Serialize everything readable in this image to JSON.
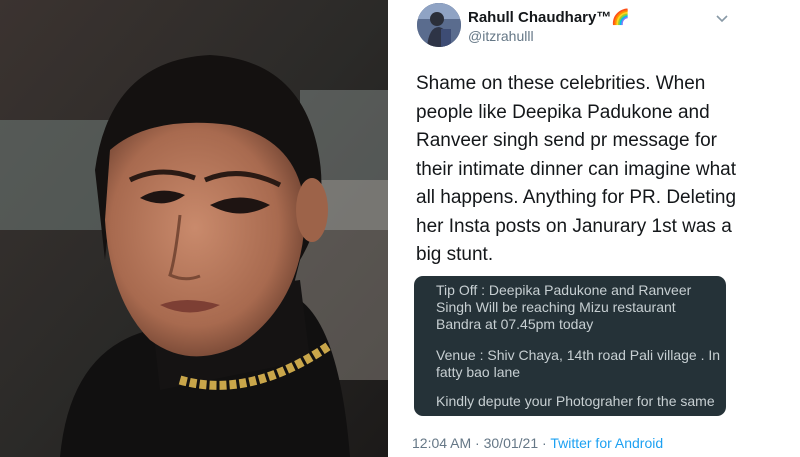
{
  "tweet": {
    "author_name": "Rahull Chaudhary™",
    "author_emoji": "🌈",
    "author_handle": "@itzrahulll",
    "menu_icon": "chevron-down-icon",
    "body_lines": [
      "Shame on these celebrities. When",
      "people like Deepika Padukone and",
      "Ranveer singh send pr message for",
      "their intimate dinner can imagine what",
      "all happens. Anything for PR. Deleting",
      "her Insta posts on Janurary 1st was a",
      "big stunt."
    ],
    "attached_message_lines": [
      "Tip Off : Deepika Padukone and Ranveer",
      "Singh Will be reaching Mizu restaurant",
      "Bandra at 07.45pm today",
      "Venue : Shiv Chaya, 14th road  Pali village . In",
      "fatty bao lane",
      "Kindly depute your Photograher for the same"
    ],
    "time": "12:04 AM",
    "date": "30/01/21",
    "separator": "·",
    "source": "Twitter for Android"
  },
  "colors": {
    "name": "#14171a",
    "secondary": "#657786",
    "link": "#1da1f2",
    "card_background": "#253238",
    "card_text": "#c7cfd2"
  }
}
